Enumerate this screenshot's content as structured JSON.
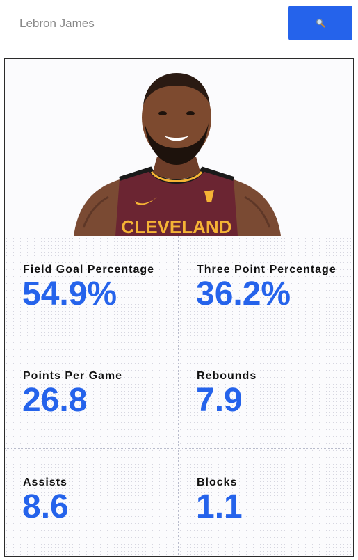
{
  "search": {
    "placeholder": "Lebron James",
    "value": "",
    "button_icon": "search-icon"
  },
  "player": {
    "photo_icon": "player-photo",
    "jersey_text": "CLEVELAND"
  },
  "stats": [
    {
      "label": "Field Goal Percentage",
      "value": "54.9%"
    },
    {
      "label": "Three Point Percentage",
      "value": "36.2%"
    },
    {
      "label": "Points Per Game",
      "value": "26.8"
    },
    {
      "label": "Rebounds",
      "value": "7.9"
    },
    {
      "label": "Assists",
      "value": "8.6"
    },
    {
      "label": "Blocks",
      "value": "1.1"
    }
  ],
  "colors": {
    "accent": "#2563eb",
    "jersey": "#6b2532",
    "jersey_gold": "#f5b335"
  }
}
